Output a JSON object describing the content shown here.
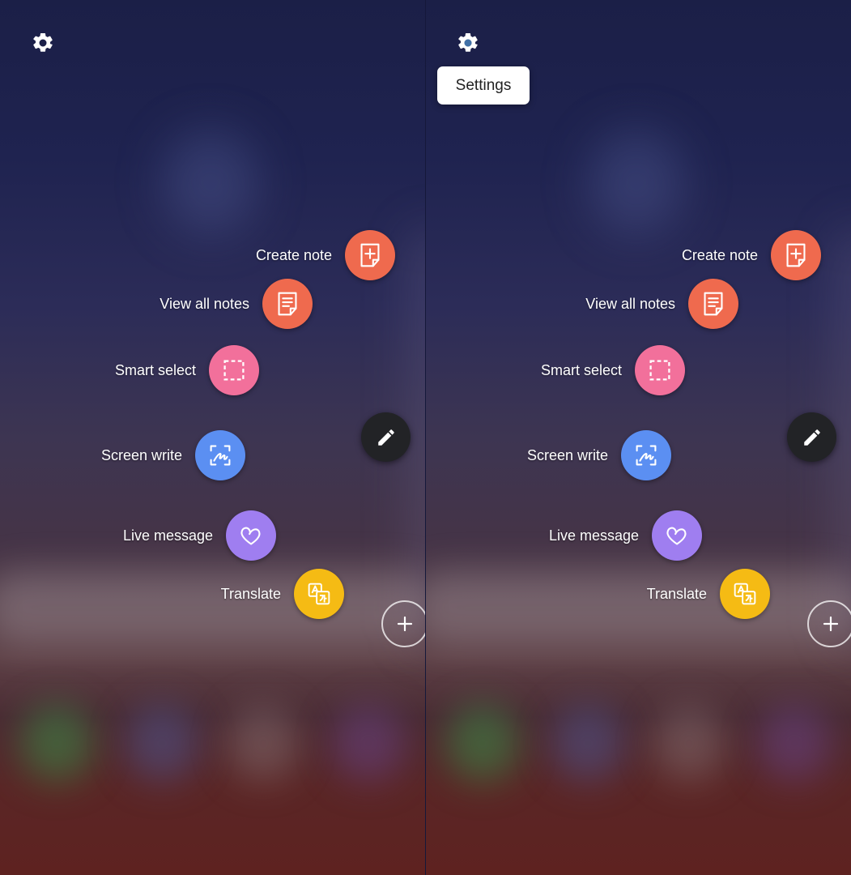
{
  "colors": {
    "create_note": "#ef6a4e",
    "view_all_notes": "#ef6a4e",
    "smart_select": "#f2709b",
    "screen_write": "#5b8ff2",
    "live_message": "#9f7ef0",
    "translate": "#f5bb14",
    "pen_button": "#222326"
  },
  "panels": [
    {
      "settings_icon": "gear-icon",
      "tooltip": "",
      "menu": [
        {
          "label": "Create note",
          "icon": "create-note-icon"
        },
        {
          "label": "View all notes",
          "icon": "view-notes-icon"
        },
        {
          "label": "Smart select",
          "icon": "smart-select-icon"
        },
        {
          "label": "Screen write",
          "icon": "screen-write-icon"
        },
        {
          "label": "Live message",
          "icon": "live-message-icon"
        },
        {
          "label": "Translate",
          "icon": "translate-icon"
        }
      ],
      "pen_icon": "pen-icon",
      "add_icon": "plus-icon"
    },
    {
      "settings_icon": "gear-icon",
      "tooltip": "Settings",
      "menu": [
        {
          "label": "Create note",
          "icon": "create-note-icon"
        },
        {
          "label": "View all notes",
          "icon": "view-notes-icon"
        },
        {
          "label": "Smart select",
          "icon": "smart-select-icon"
        },
        {
          "label": "Screen write",
          "icon": "screen-write-icon"
        },
        {
          "label": "Live message",
          "icon": "live-message-icon"
        },
        {
          "label": "Translate",
          "icon": "translate-icon"
        }
      ],
      "pen_icon": "pen-icon",
      "add_icon": "plus-icon"
    }
  ]
}
